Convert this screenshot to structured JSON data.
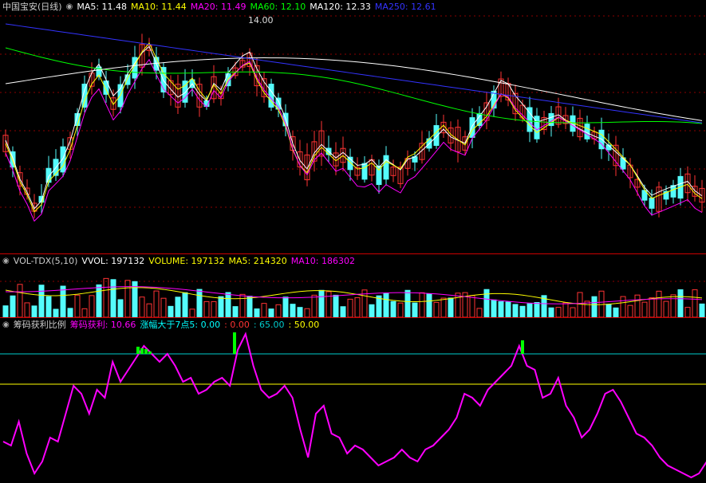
{
  "main": {
    "title": "中国宝安(日线)",
    "indicators": [
      {
        "label": "MA5: 11.48",
        "color": "#ffffff"
      },
      {
        "label": "MA10: 11.44",
        "color": "#ffff00"
      },
      {
        "label": "MA20: 11.49",
        "color": "#ff00ff"
      },
      {
        "label": "MA60: 12.10",
        "color": "#00ff00"
      },
      {
        "label": "MA120: 12.33",
        "color": "#ffffff"
      },
      {
        "label": "MA250: 12.61",
        "color": "#3333ff"
      }
    ],
    "high_mark": "14.00"
  },
  "vol": {
    "title": "VOL-TDX(5,10)",
    "indicators": [
      {
        "label": "VVOL: 197132",
        "color": "#ffffff"
      },
      {
        "label": "VOLUME: 197132",
        "color": "#ffff00"
      },
      {
        "label": "MA5: 214320",
        "color": "#ffff00"
      },
      {
        "label": "MA10: 186302",
        "color": "#ff00ff"
      }
    ]
  },
  "chip": {
    "title": "筹码获利比例",
    "indicators": [
      {
        "label": "筹码获利: 10.66",
        "color": "#ff00ff"
      },
      {
        "label": "涨幅大于7点5: 0.00",
        "color": "#00ffff"
      },
      {
        "label": ": 0.00",
        "color": "#ff3333"
      },
      {
        "label": ": 65.00",
        "color": "#00cccc"
      },
      {
        "label": ": 50.00",
        "color": "#ffff00"
      }
    ]
  },
  "colors": {
    "up": "#ff3333",
    "down": "#54fcfc",
    "grid": "#8b0000",
    "profit": "#ff00ff",
    "alert": "#00ff00",
    "line65": "#00cccc",
    "line50": "#ffff00"
  }
}
